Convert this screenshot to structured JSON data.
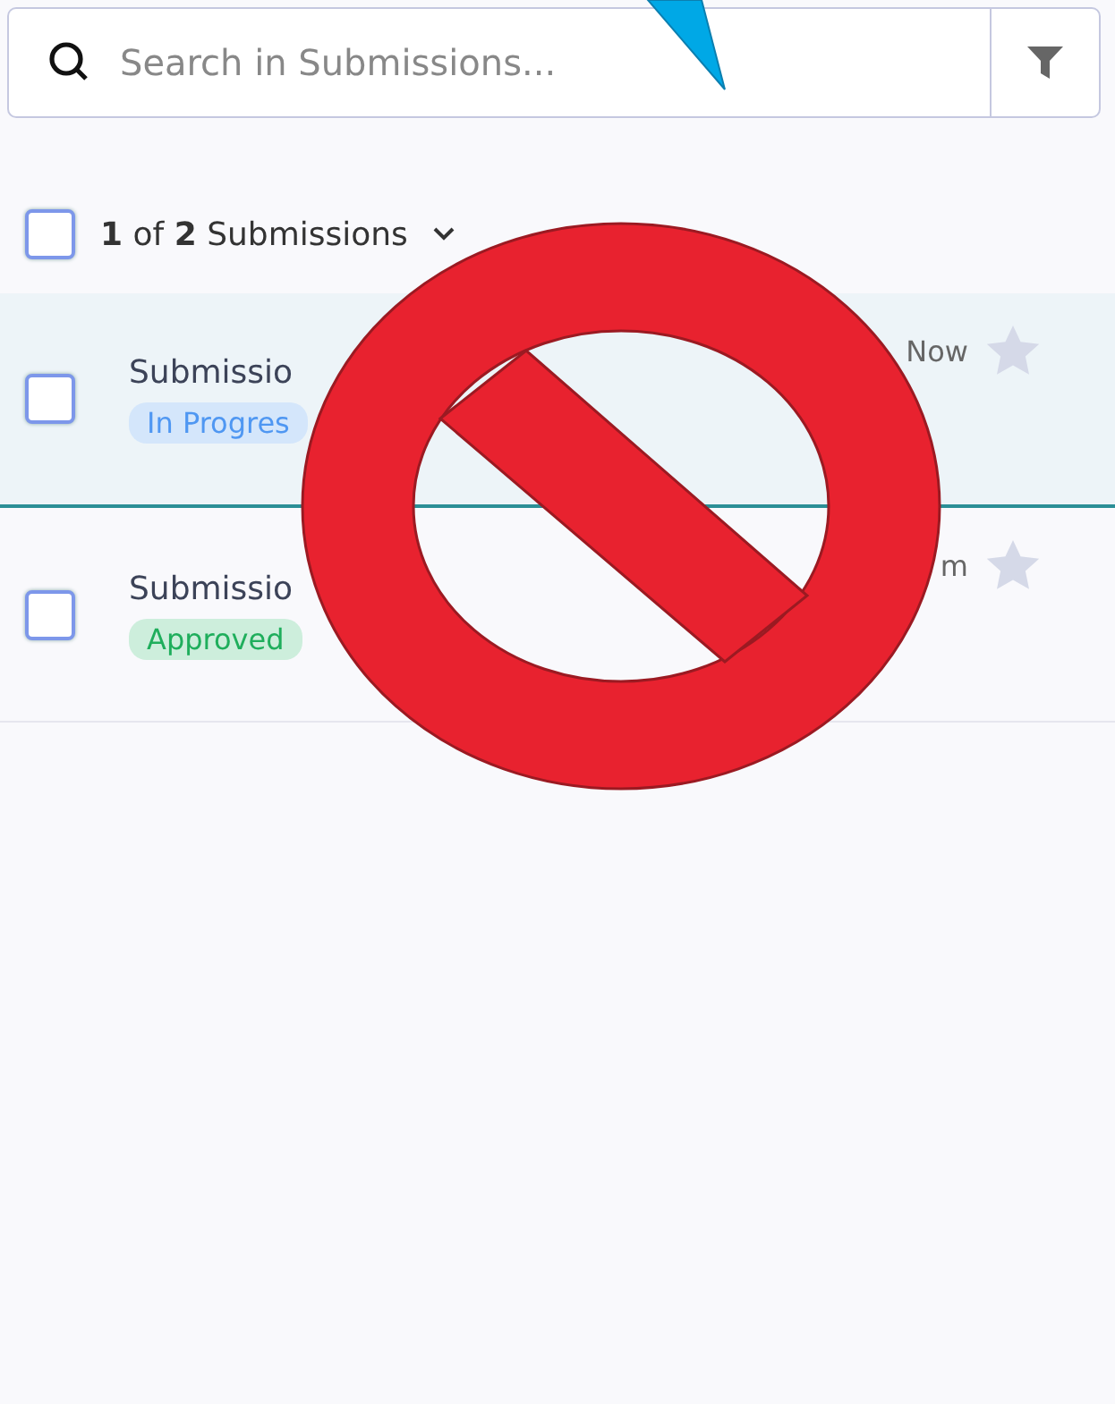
{
  "search": {
    "placeholder": "Search in Submissions..."
  },
  "list_header": {
    "checked": false,
    "count": "**1** of **2** Submissions"
  },
  "submissions": [
    {
      "title": "Submissio",
      "status": "In Progres",
      "kind": "progress",
      "time": "Now",
      "checked": false,
      "selected": true,
      "starred": false
    },
    {
      "title": "Submissio",
      "status": "Approved",
      "kind": "approved",
      "time": "m",
      "checked": false,
      "selected": false,
      "starred": false
    }
  ]
}
